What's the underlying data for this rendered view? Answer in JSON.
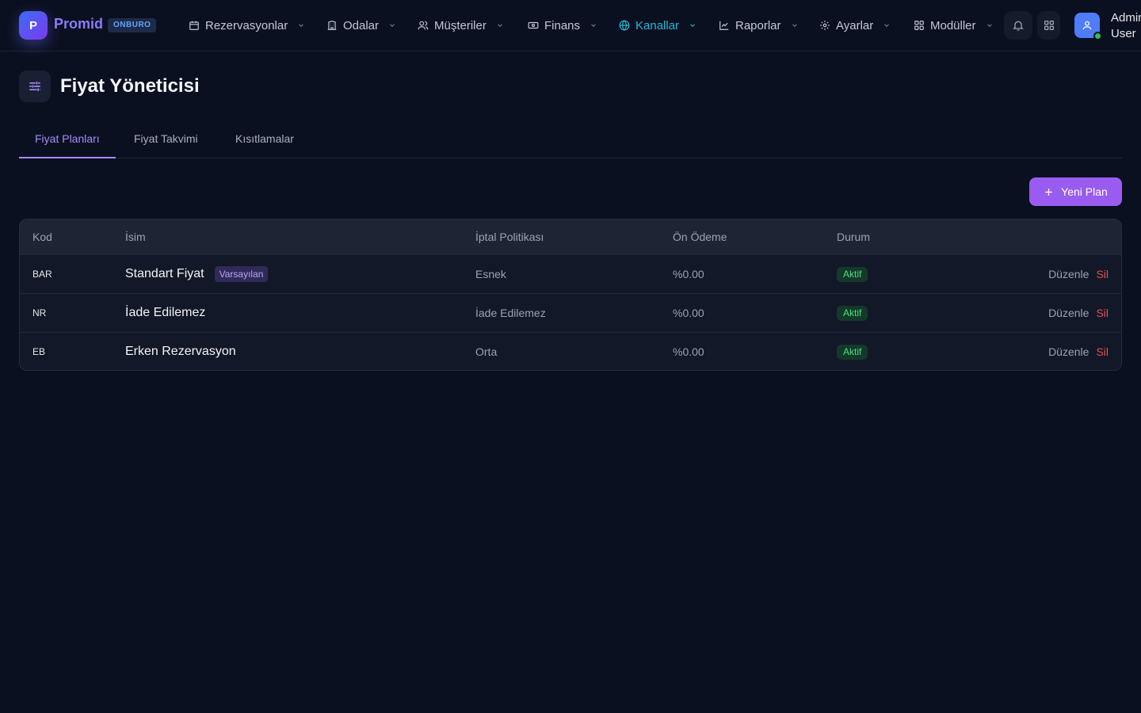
{
  "brand": {
    "logo_letter": "P",
    "name": "Promid",
    "badge": "ONBURO"
  },
  "nav": [
    {
      "id": "rezervasyonlar",
      "label": "Rezervasyonlar",
      "icon": "calendar-icon",
      "active": false
    },
    {
      "id": "odalar",
      "label": "Odalar",
      "icon": "building-icon",
      "active": false
    },
    {
      "id": "musteriler",
      "label": "Müşteriler",
      "icon": "users-icon",
      "active": false
    },
    {
      "id": "finans",
      "label": "Finans",
      "icon": "banknote-icon",
      "active": false
    },
    {
      "id": "kanallar",
      "label": "Kanallar",
      "icon": "globe-icon",
      "active": true
    },
    {
      "id": "raporlar",
      "label": "Raporlar",
      "icon": "chart-icon",
      "active": false
    },
    {
      "id": "ayarlar",
      "label": "Ayarlar",
      "icon": "gear-icon",
      "active": false
    },
    {
      "id": "moduller",
      "label": "Modüller",
      "icon": "grid-icon",
      "active": false
    }
  ],
  "user": {
    "name_line1": "Admin",
    "name_line2": "User"
  },
  "page": {
    "title": "Fiyat Yöneticisi",
    "icon": "sliders-icon"
  },
  "tabs": [
    {
      "label": "Fiyat Planları",
      "active": true
    },
    {
      "label": "Fiyat Takvimi",
      "active": false
    },
    {
      "label": "Kısıtlamalar",
      "active": false
    }
  ],
  "actions": {
    "new_plan_label": "Yeni Plan"
  },
  "table": {
    "headers": {
      "code": "Kod",
      "name": "İsim",
      "cancel": "İptal Politikası",
      "prepay": "Ön Ödeme",
      "status": "Durum"
    },
    "rows": [
      {
        "code": "BAR",
        "name": "Standart Fiyat",
        "tag": "Varsayılan",
        "cancel": "Esnek",
        "prepay": "%0.00",
        "status": "Aktif",
        "edit": "Düzenle",
        "delete": "Sil"
      },
      {
        "code": "NR",
        "name": "İade Edilemez",
        "tag": "",
        "cancel": "İade Edilemez",
        "prepay": "%0.00",
        "status": "Aktif",
        "edit": "Düzenle",
        "delete": "Sil"
      },
      {
        "code": "EB",
        "name": "Erken Rezervasyon",
        "tag": "",
        "cancel": "Orta",
        "prepay": "%0.00",
        "status": "Aktif",
        "edit": "Düzenle",
        "delete": "Sil"
      }
    ]
  },
  "colors": {
    "background": "#0b1020",
    "accent": "#9a5cf0",
    "active_nav": "#22b8d8",
    "status_active": "#4ade80",
    "danger": "#e05050"
  }
}
